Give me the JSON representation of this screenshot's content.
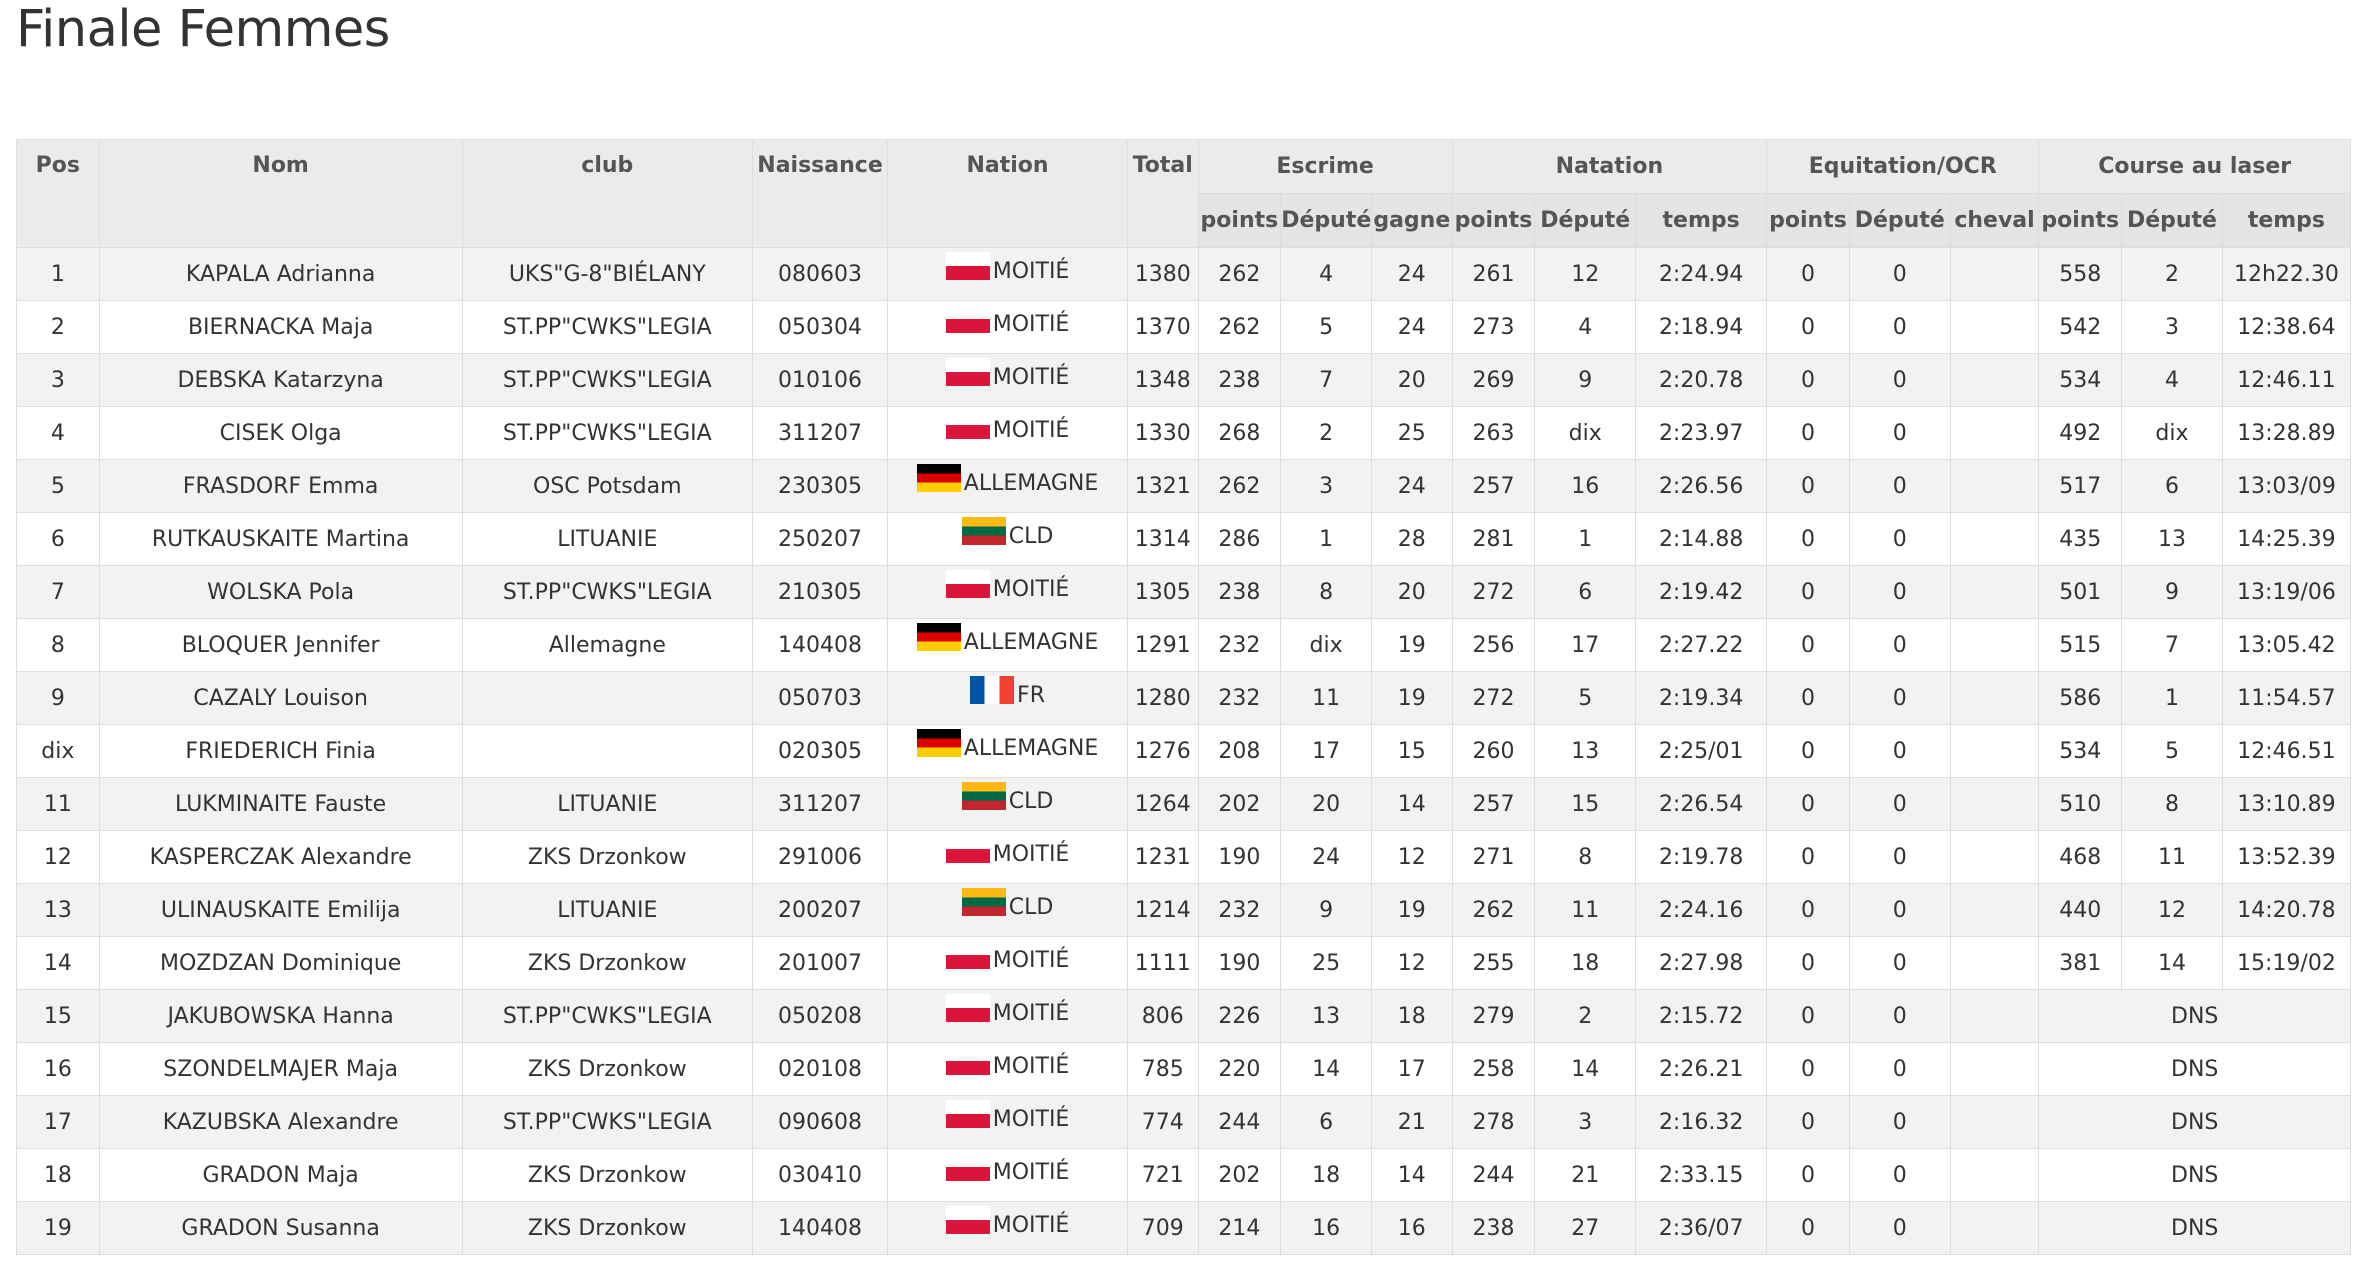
{
  "page_title": "Finale Femmes",
  "headers": {
    "pos": "Pos",
    "nom": "Nom",
    "club": "club",
    "naissance": "Naissance",
    "nation": "Nation",
    "total": "Total",
    "escrime": "Escrime",
    "natation": "Natation",
    "equitation": "Equitation/OCR",
    "course": "Course au laser",
    "points": "points",
    "depute": "Député",
    "gagne": "gagne",
    "temps": "temps",
    "cheval": "cheval"
  },
  "rows": [
    {
      "pos": "1",
      "nom": "KAPALA Adrianna",
      "club": "UKS\"G-8\"BIÉLANY",
      "naissance": "080603",
      "flag": "pl",
      "nation": "MOITIÉ",
      "total": "1380",
      "esc_points": "262",
      "esc_depute": "4",
      "esc_gagne": "24",
      "nat_points": "261",
      "nat_depute": "12",
      "nat_temps": "2:24.94",
      "eq_points": "0",
      "eq_depute": "0",
      "eq_cheval": "",
      "cl_points": "558",
      "cl_depute": "2",
      "cl_temps": "12h22.30"
    },
    {
      "pos": "2",
      "nom": "BIERNACKA Maja",
      "club": "ST.PP\"CWKS\"LEGIA",
      "naissance": "050304",
      "flag": "pl",
      "nation": "MOITIÉ",
      "total": "1370",
      "esc_points": "262",
      "esc_depute": "5",
      "esc_gagne": "24",
      "nat_points": "273",
      "nat_depute": "4",
      "nat_temps": "2:18.94",
      "eq_points": "0",
      "eq_depute": "0",
      "eq_cheval": "",
      "cl_points": "542",
      "cl_depute": "3",
      "cl_temps": "12:38.64"
    },
    {
      "pos": "3",
      "nom": "DEBSKA Katarzyna",
      "club": "ST.PP\"CWKS\"LEGIA",
      "naissance": "010106",
      "flag": "pl",
      "nation": "MOITIÉ",
      "total": "1348",
      "esc_points": "238",
      "esc_depute": "7",
      "esc_gagne": "20",
      "nat_points": "269",
      "nat_depute": "9",
      "nat_temps": "2:20.78",
      "eq_points": "0",
      "eq_depute": "0",
      "eq_cheval": "",
      "cl_points": "534",
      "cl_depute": "4",
      "cl_temps": "12:46.11"
    },
    {
      "pos": "4",
      "nom": "CISEK Olga",
      "club": "ST.PP\"CWKS\"LEGIA",
      "naissance": "311207",
      "flag": "pl",
      "nation": "MOITIÉ",
      "total": "1330",
      "esc_points": "268",
      "esc_depute": "2",
      "esc_gagne": "25",
      "nat_points": "263",
      "nat_depute": "dix",
      "nat_temps": "2:23.97",
      "eq_points": "0",
      "eq_depute": "0",
      "eq_cheval": "",
      "cl_points": "492",
      "cl_depute": "dix",
      "cl_temps": "13:28.89"
    },
    {
      "pos": "5",
      "nom": "FRASDORF Emma",
      "club": "OSC Potsdam",
      "naissance": "230305",
      "flag": "de",
      "nation": "ALLEMAGNE",
      "total": "1321",
      "esc_points": "262",
      "esc_depute": "3",
      "esc_gagne": "24",
      "nat_points": "257",
      "nat_depute": "16",
      "nat_temps": "2:26.56",
      "eq_points": "0",
      "eq_depute": "0",
      "eq_cheval": "",
      "cl_points": "517",
      "cl_depute": "6",
      "cl_temps": "13:03/09"
    },
    {
      "pos": "6",
      "nom": "RUTKAUSKAITE Martina",
      "club": "LITUANIE",
      "naissance": "250207",
      "flag": "lt",
      "nation": "CLD",
      "total": "1314",
      "esc_points": "286",
      "esc_depute": "1",
      "esc_gagne": "28",
      "nat_points": "281",
      "nat_depute": "1",
      "nat_temps": "2:14.88",
      "eq_points": "0",
      "eq_depute": "0",
      "eq_cheval": "",
      "cl_points": "435",
      "cl_depute": "13",
      "cl_temps": "14:25.39"
    },
    {
      "pos": "7",
      "nom": "WOLSKA Pola",
      "club": "ST.PP\"CWKS\"LEGIA",
      "naissance": "210305",
      "flag": "pl",
      "nation": "MOITIÉ",
      "total": "1305",
      "esc_points": "238",
      "esc_depute": "8",
      "esc_gagne": "20",
      "nat_points": "272",
      "nat_depute": "6",
      "nat_temps": "2:19.42",
      "eq_points": "0",
      "eq_depute": "0",
      "eq_cheval": "",
      "cl_points": "501",
      "cl_depute": "9",
      "cl_temps": "13:19/06"
    },
    {
      "pos": "8",
      "nom": "BLOQUER Jennifer",
      "club": "Allemagne",
      "naissance": "140408",
      "flag": "de",
      "nation": "ALLEMAGNE",
      "total": "1291",
      "esc_points": "232",
      "esc_depute": "dix",
      "esc_gagne": "19",
      "nat_points": "256",
      "nat_depute": "17",
      "nat_temps": "2:27.22",
      "eq_points": "0",
      "eq_depute": "0",
      "eq_cheval": "",
      "cl_points": "515",
      "cl_depute": "7",
      "cl_temps": "13:05.42"
    },
    {
      "pos": "9",
      "nom": "CAZALY Louison",
      "club": "",
      "naissance": "050703",
      "flag": "fr",
      "nation": "FR",
      "total": "1280",
      "esc_points": "232",
      "esc_depute": "11",
      "esc_gagne": "19",
      "nat_points": "272",
      "nat_depute": "5",
      "nat_temps": "2:19.34",
      "eq_points": "0",
      "eq_depute": "0",
      "eq_cheval": "",
      "cl_points": "586",
      "cl_depute": "1",
      "cl_temps": "11:54.57"
    },
    {
      "pos": "dix",
      "nom": "FRIEDERICH Finia",
      "club": "",
      "naissance": "020305",
      "flag": "de",
      "nation": "ALLEMAGNE",
      "total": "1276",
      "esc_points": "208",
      "esc_depute": "17",
      "esc_gagne": "15",
      "nat_points": "260",
      "nat_depute": "13",
      "nat_temps": "2:25/01",
      "eq_points": "0",
      "eq_depute": "0",
      "eq_cheval": "",
      "cl_points": "534",
      "cl_depute": "5",
      "cl_temps": "12:46.51"
    },
    {
      "pos": "11",
      "nom": "LUKMINAITE Fauste",
      "club": "LITUANIE",
      "naissance": "311207",
      "flag": "lt",
      "nation": "CLD",
      "total": "1264",
      "esc_points": "202",
      "esc_depute": "20",
      "esc_gagne": "14",
      "nat_points": "257",
      "nat_depute": "15",
      "nat_temps": "2:26.54",
      "eq_points": "0",
      "eq_depute": "0",
      "eq_cheval": "",
      "cl_points": "510",
      "cl_depute": "8",
      "cl_temps": "13:10.89"
    },
    {
      "pos": "12",
      "nom": "KASPERCZAK Alexandre",
      "club": "ZKS Drzonkow",
      "naissance": "291006",
      "flag": "pl",
      "nation": "MOITIÉ",
      "total": "1231",
      "esc_points": "190",
      "esc_depute": "24",
      "esc_gagne": "12",
      "nat_points": "271",
      "nat_depute": "8",
      "nat_temps": "2:19.78",
      "eq_points": "0",
      "eq_depute": "0",
      "eq_cheval": "",
      "cl_points": "468",
      "cl_depute": "11",
      "cl_temps": "13:52.39"
    },
    {
      "pos": "13",
      "nom": "ULINAUSKAITE Emilija",
      "club": "LITUANIE",
      "naissance": "200207",
      "flag": "lt",
      "nation": "CLD",
      "total": "1214",
      "esc_points": "232",
      "esc_depute": "9",
      "esc_gagne": "19",
      "nat_points": "262",
      "nat_depute": "11",
      "nat_temps": "2:24.16",
      "eq_points": "0",
      "eq_depute": "0",
      "eq_cheval": "",
      "cl_points": "440",
      "cl_depute": "12",
      "cl_temps": "14:20.78"
    },
    {
      "pos": "14",
      "nom": "MOZDZAN Dominique",
      "club": "ZKS Drzonkow",
      "naissance": "201007",
      "flag": "pl",
      "nation": "MOITIÉ",
      "total": "1111",
      "esc_points": "190",
      "esc_depute": "25",
      "esc_gagne": "12",
      "nat_points": "255",
      "nat_depute": "18",
      "nat_temps": "2:27.98",
      "eq_points": "0",
      "eq_depute": "0",
      "eq_cheval": "",
      "cl_points": "381",
      "cl_depute": "14",
      "cl_temps": "15:19/02"
    },
    {
      "pos": "15",
      "nom": "JAKUBOWSKA Hanna",
      "club": "ST.PP\"CWKS\"LEGIA",
      "naissance": "050208",
      "flag": "pl",
      "nation": "MOITIÉ",
      "total": "806",
      "esc_points": "226",
      "esc_depute": "13",
      "esc_gagne": "18",
      "nat_points": "279",
      "nat_depute": "2",
      "nat_temps": "2:15.72",
      "eq_points": "0",
      "eq_depute": "0",
      "eq_cheval": "",
      "cl_status": "DNS"
    },
    {
      "pos": "16",
      "nom": "SZONDELMAJER Maja",
      "club": "ZKS Drzonkow",
      "naissance": "020108",
      "flag": "pl",
      "nation": "MOITIÉ",
      "total": "785",
      "esc_points": "220",
      "esc_depute": "14",
      "esc_gagne": "17",
      "nat_points": "258",
      "nat_depute": "14",
      "nat_temps": "2:26.21",
      "eq_points": "0",
      "eq_depute": "0",
      "eq_cheval": "",
      "cl_status": "DNS"
    },
    {
      "pos": "17",
      "nom": "KAZUBSKA Alexandre",
      "club": "ST.PP\"CWKS\"LEGIA",
      "naissance": "090608",
      "flag": "pl",
      "nation": "MOITIÉ",
      "total": "774",
      "esc_points": "244",
      "esc_depute": "6",
      "esc_gagne": "21",
      "nat_points": "278",
      "nat_depute": "3",
      "nat_temps": "2:16.32",
      "eq_points": "0",
      "eq_depute": "0",
      "eq_cheval": "",
      "cl_status": "DNS"
    },
    {
      "pos": "18",
      "nom": "GRADON Maja",
      "club": "ZKS Drzonkow",
      "naissance": "030410",
      "flag": "pl",
      "nation": "MOITIÉ",
      "total": "721",
      "esc_points": "202",
      "esc_depute": "18",
      "esc_gagne": "14",
      "nat_points": "244",
      "nat_depute": "21",
      "nat_temps": "2:33.15",
      "eq_points": "0",
      "eq_depute": "0",
      "eq_cheval": "",
      "cl_status": "DNS"
    },
    {
      "pos": "19",
      "nom": "GRADON Susanna",
      "club": "ZKS Drzonkow",
      "naissance": "140408",
      "flag": "pl",
      "nation": "MOITIÉ",
      "total": "709",
      "esc_points": "214",
      "esc_depute": "16",
      "esc_gagne": "16",
      "nat_points": "238",
      "nat_depute": "27",
      "nat_temps": "2:36/07",
      "eq_points": "0",
      "eq_depute": "0",
      "eq_cheval": "",
      "cl_status": "DNS"
    }
  ]
}
